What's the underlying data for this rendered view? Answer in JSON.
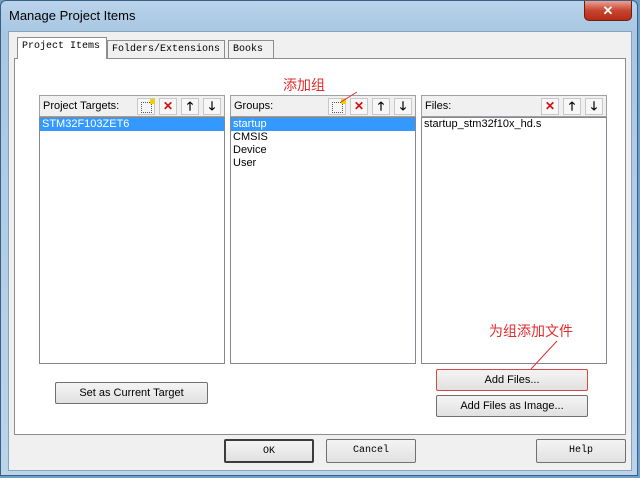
{
  "window": {
    "title": "Manage Project Items",
    "close_glyph": "✕"
  },
  "tabs": [
    {
      "label": "Project Items",
      "active": true
    },
    {
      "label": "Folders/Extensions",
      "active": false
    },
    {
      "label": "Books",
      "active": false
    }
  ],
  "targets": {
    "header": "Project Targets:",
    "items": [
      "STM32F103ZET6"
    ],
    "selected": 0
  },
  "groups": {
    "header": "Groups:",
    "items": [
      "startup",
      "CMSIS",
      "Device",
      "User"
    ],
    "selected": 0
  },
  "files": {
    "header": "Files:",
    "items": [
      "startup_stm32f10x_hd.s"
    ],
    "selected": -1
  },
  "icons": {
    "new": "new-item-icon",
    "delete": "delete-x-icon",
    "up": "move-up-arrow-icon",
    "down": "move-down-arrow-icon"
  },
  "buttons": {
    "set_current_target": "Set as Current Target",
    "add_files": "Add Files...",
    "add_files_image": "Add Files as Image...",
    "ok": "OK",
    "cancel": "Cancel",
    "help": "Help"
  },
  "annotations": {
    "add_group": "添加组",
    "add_files_to_group": "为组添加文件"
  },
  "colors": {
    "selection": "#3399ff",
    "annotation": "#e12d2d",
    "delete_icon": "#d01010"
  }
}
